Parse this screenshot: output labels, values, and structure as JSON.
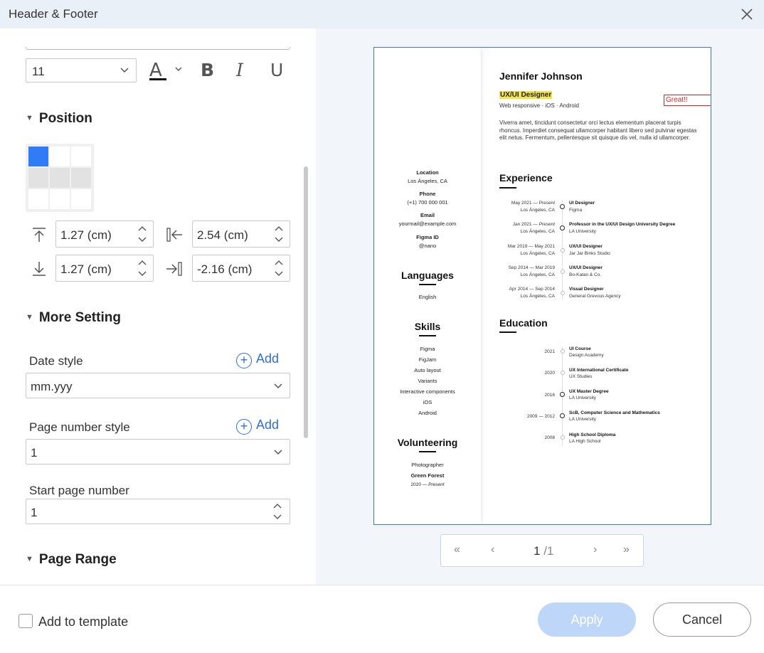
{
  "dialog": {
    "title": "Header & Footer"
  },
  "format": {
    "font_size": "11",
    "color_glyph": "A",
    "bold_glyph": "B",
    "italic_glyph": "I",
    "underline_glyph": "U"
  },
  "position": {
    "heading": "Position",
    "grid_selected": "top-left",
    "top_margin": "1.27 (cm)",
    "left_margin": "2.54 (cm)",
    "bottom_margin": "1.27 (cm)",
    "right_margin": "-2.16 (cm)"
  },
  "more": {
    "heading": "More Setting",
    "date_style_label": "Date style",
    "date_style_value": "mm.yyy",
    "page_number_style_label": "Page number style",
    "page_number_style_value": "1",
    "start_page_label": "Start page number",
    "start_page_value": "1",
    "add_label": "Add"
  },
  "page_range": {
    "heading": "Page Range"
  },
  "preview": {
    "name": "Jennifer Johnson",
    "role": "UX/UI Designer",
    "subtitle": "Web responsive · iOS · Android",
    "annotation": "Great!!",
    "summary": "Viverra amet, tincidunt consectetur orci lectus elementum placerat turpis rhoncus. Imperdiet consequat ullamcorper habitant libero sed pulvinar egestas elit netus. Fermentum, pellentesque sit quisque dis vel, nulla id ullamcorper.",
    "contact": [
      {
        "label": "Location",
        "value": "Los Ángeles, CA"
      },
      {
        "label": "Phone",
        "value": "(+1) 700 000 001"
      },
      {
        "label": "Email",
        "value": "yourmail@example.com"
      },
      {
        "label": "Figma ID",
        "value": "@nano"
      }
    ],
    "languages_heading": "Languages",
    "languages": [
      "English"
    ],
    "skills_heading": "Skills",
    "skills": [
      "Figma",
      "FigJam",
      "Auto layout",
      "Variants",
      "Interactive components",
      "iOS",
      "Android"
    ],
    "volunteering_heading": "Volunteering",
    "volunteering": {
      "role": "Photographer",
      "org": "Green Forest",
      "years": "2020 —",
      "present": "Present"
    },
    "experience_heading": "Experience",
    "experience": [
      {
        "dates": "May 2021 —",
        "present": "Present",
        "place": "Los Ángeles, CA",
        "title": "UI Designer",
        "company": "Figma"
      },
      {
        "dates": "Jan 2021 —",
        "present": "Present",
        "place": "Los Ángeles, CA",
        "title": "Professor in the UX/UI Design University Degree",
        "company": "LA University"
      },
      {
        "dates": "Mar 2019 — May 2021",
        "present": "",
        "place": "Los Ángeles, CA",
        "title": "UX/UI Designer",
        "company": "Jar Jar Binks Studio"
      },
      {
        "dates": "Sep 2014 — Mar 2019",
        "present": "",
        "place": "Los Ángeles, CA",
        "title": "UX/UI Designer",
        "company": "Bo-Katan & Co."
      },
      {
        "dates": "Apr 2014 — Sep 2014",
        "present": "",
        "place": "Los Ángeles, CA",
        "title": "Visual Designer",
        "company": "General Grevous Agency"
      }
    ],
    "education_heading": "Education",
    "education": [
      {
        "year": "2021",
        "title": "UI Course",
        "school": "Design Academy"
      },
      {
        "year": "2020",
        "title": "UX International Certificate",
        "school": "UX Studies"
      },
      {
        "year": "2016",
        "title": "UX Master Degree",
        "school": "LA University"
      },
      {
        "year": "2009 — 2012",
        "title": "ScB, Computer Science and Mathematics",
        "school": "LA University"
      },
      {
        "year": "2008",
        "title": "High School Diploma",
        "school": "LA High School"
      }
    ]
  },
  "pager": {
    "first": "«",
    "prev": "‹",
    "next": "›",
    "last": "»",
    "current": "1",
    "total": "/1"
  },
  "footer": {
    "add_to_template": "Add to template",
    "apply": "Apply",
    "cancel": "Cancel"
  }
}
